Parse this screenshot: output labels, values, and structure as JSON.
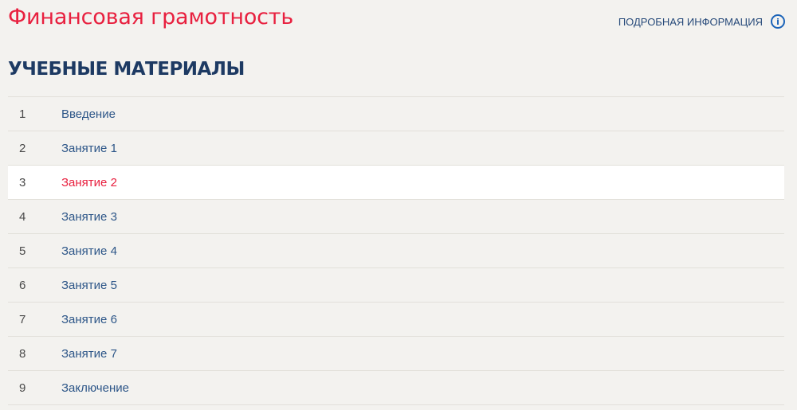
{
  "header": {
    "course_title": "Финансовая грамотность",
    "info_label": "ПОДРОБНАЯ ИНФОРМАЦИЯ",
    "info_icon": "info-circle-icon"
  },
  "section": {
    "title": "УЧЕБНЫЕ МАТЕРИАЛЫ"
  },
  "materials": [
    {
      "num": "1",
      "label": "Введение",
      "active": false
    },
    {
      "num": "2",
      "label": "Занятие 1",
      "active": false
    },
    {
      "num": "3",
      "label": "Занятие 2",
      "active": true
    },
    {
      "num": "4",
      "label": "Занятие 3",
      "active": false
    },
    {
      "num": "5",
      "label": "Занятие 4",
      "active": false
    },
    {
      "num": "6",
      "label": "Занятие 5",
      "active": false
    },
    {
      "num": "7",
      "label": "Занятие 6",
      "active": false
    },
    {
      "num": "8",
      "label": "Занятие 7",
      "active": false
    },
    {
      "num": "9",
      "label": "Заключение",
      "active": false
    }
  ],
  "colors": {
    "accent_red": "#e8203f",
    "link_blue": "#2d5688",
    "heading_navy": "#1d3a63",
    "background": "#f3f2ef",
    "active_row": "#ffffff"
  }
}
